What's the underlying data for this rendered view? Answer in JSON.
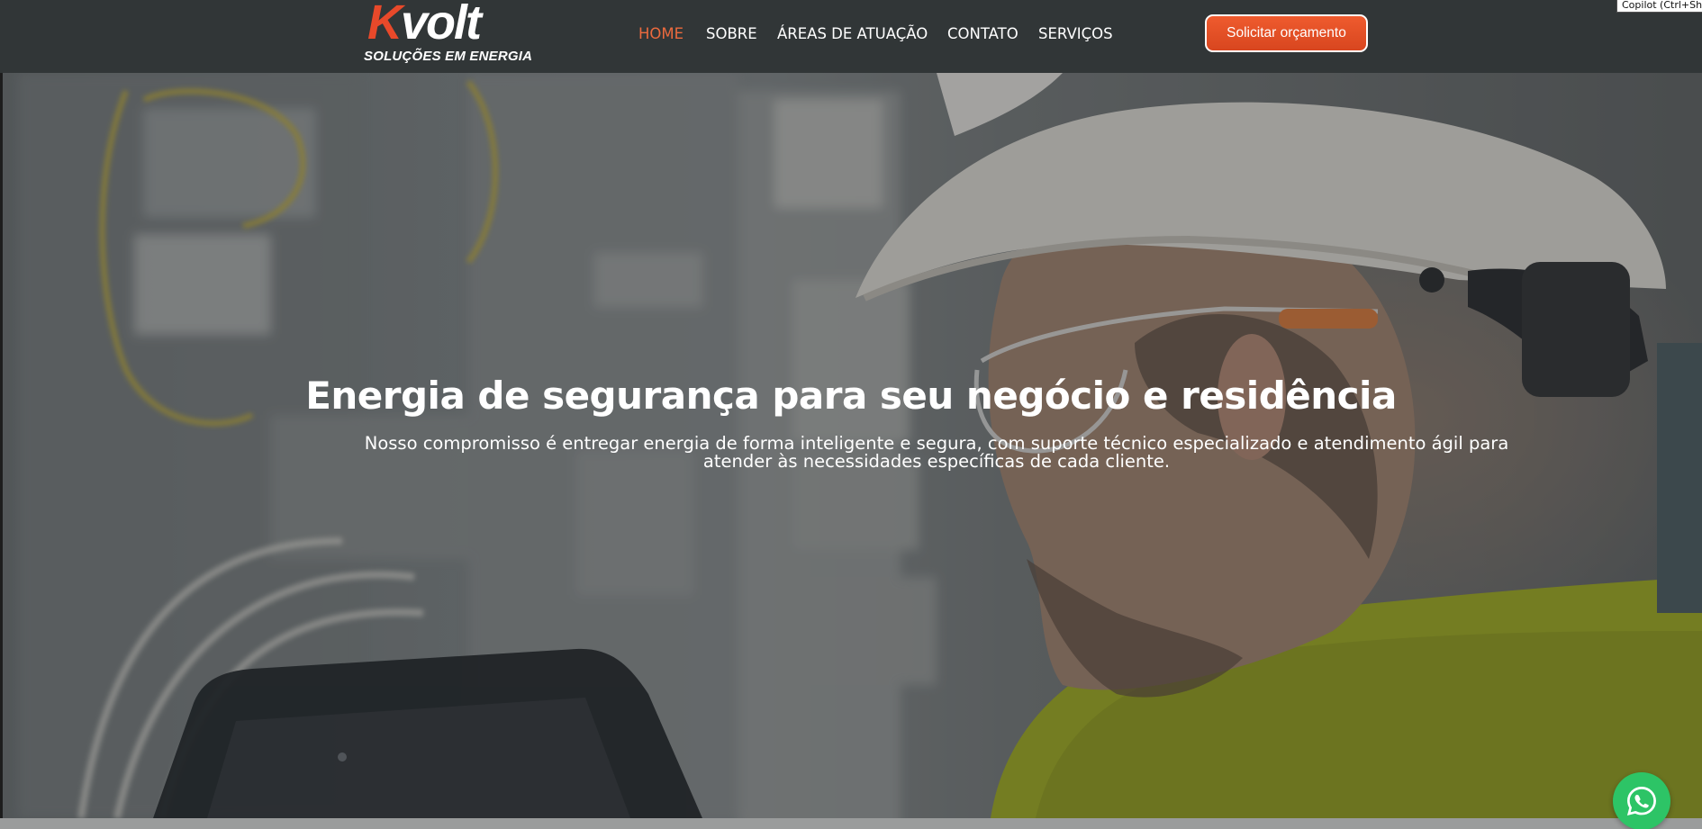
{
  "brand": {
    "logo_letter": "K",
    "logo_rest": "volt",
    "tagline": "SOLUÇÕES EM ENERGIA"
  },
  "nav": {
    "items": [
      {
        "label": "HOME",
        "active": true
      },
      {
        "label": "SOBRE",
        "active": false
      },
      {
        "label": "ÁREAS DE ATUAÇÃO",
        "active": false
      },
      {
        "label": "CONTATO",
        "active": false
      },
      {
        "label": "SERVIÇOS",
        "active": false
      }
    ]
  },
  "cta": {
    "label": "Solicitar orçamento"
  },
  "tooltip": {
    "text": "Copilot (Ctrl+Shi"
  },
  "hero": {
    "title": "Energia de segurança para seu negócio e residência",
    "subtitle": "Nosso compromisso é entregar energia de forma inteligente e segura, com suporte técnico especializado e atendimento ágil para atender às necessidades específicas de cada cliente."
  },
  "floating": {
    "icon": "whatsapp-icon"
  },
  "colors": {
    "header_bg": "#313637",
    "accent": "#e8492a",
    "nav_active": "#ec6a3e",
    "whatsapp": "#2dc466"
  }
}
